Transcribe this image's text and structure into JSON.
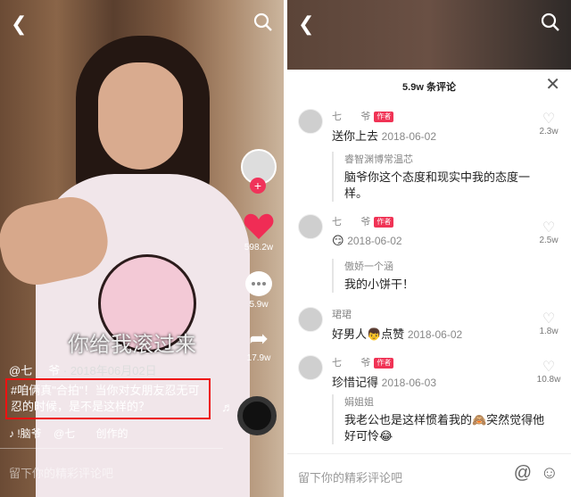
{
  "left": {
    "likes": "598.2w",
    "comments": "5.9w",
    "shares": "17.9w",
    "subtitle": "你给我滚过来",
    "author": "@七     爷",
    "date": "· 2018年06月02日",
    "caption": "#咱俩真\"合拍\"！当你对女朋友忍无可忍的时候，是不是这样的？",
    "music": "♪ !脑爷    @七       创作的",
    "input_placeholder": "留下你的精彩评论吧"
  },
  "right": {
    "title": "5.9w 条评论",
    "comments": [
      {
        "name": "七       爷",
        "author_tag": "作者",
        "text": "送你上去",
        "date": "2018-06-02",
        "likes": "2.3w",
        "reply_name": "睿智渊博常温芯",
        "reply_text": "脑爷你这个态度和现实中我的态度一样。"
      },
      {
        "name": "七       爷",
        "author_tag": "作者",
        "text": "😏",
        "date": "2018-06-02",
        "likes": "2.5w",
        "reply_name": "傲娇一个涵",
        "reply_text": "我的小饼干！"
      },
      {
        "name": "珺珺",
        "text": "好男人👦点赞",
        "date": "2018-06-02",
        "likes": "1.8w"
      },
      {
        "name": "七       爷",
        "author_tag": "作者",
        "text": "珍惜记得",
        "date": "2018-06-03",
        "likes": "10.8w",
        "reply_name": "娟姐姐",
        "reply_text": "我老公也是这样惯着我的🙈突然觉得他好可怜😂"
      }
    ],
    "input_placeholder": "留下你的精彩评论吧"
  }
}
